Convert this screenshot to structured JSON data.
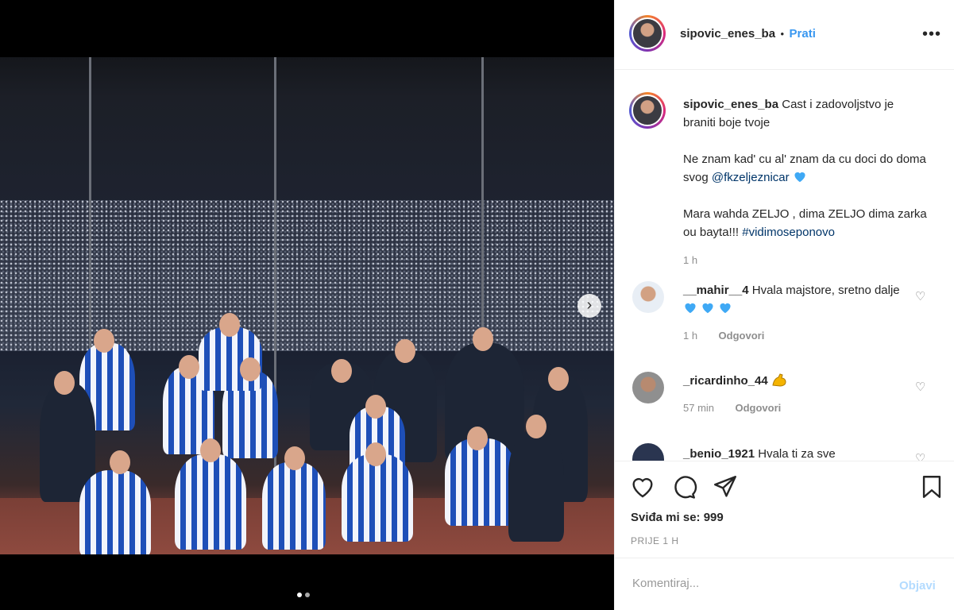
{
  "post": {
    "username": "sipovic_enes_ba",
    "separator": "•",
    "follow_label": "Prati",
    "more_label": "•••",
    "carousel_next": "›"
  },
  "caption": {
    "username": "sipovic_enes_ba",
    "line1": "Cast i zadovoljstvo je braniti boje tvoje",
    "line2": "Ne znam kad' cu al' znam da cu doci do doma svog",
    "mention": "@fkzeljeznicar",
    "line3": "Mara wahda ZELJO , dima ZELJO dima zarka ou bayta!!!",
    "hashtag": "#vidimoseponovo",
    "time": "1 h"
  },
  "comments": [
    {
      "username": "__mahir__4",
      "text": "Hvala majstore, sretno dalje",
      "time": "1 h",
      "reply": "Odgovori"
    },
    {
      "username": "_ricardinho_44",
      "text": "",
      "time": "57 min",
      "reply": "Odgovori"
    },
    {
      "username": "_benio_1921",
      "text": "Hvala ti za sve"
    }
  ],
  "likes": "Sviđa mi se: 999",
  "timestamp": "PRIJE 1 H",
  "composer": {
    "placeholder": "Komentiraj...",
    "post_label": "Objavi"
  },
  "colors": {
    "accent": "#3897f0",
    "heart_emoji": "#3fa9f5",
    "muscle_emoji": "#f5b400"
  }
}
